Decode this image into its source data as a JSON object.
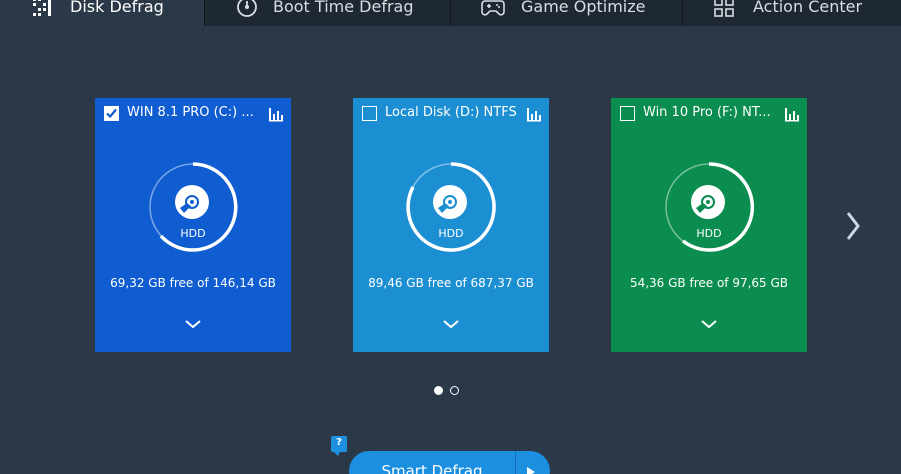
{
  "tabs": [
    {
      "label": "Disk Defrag",
      "icon": "disk-defrag-icon",
      "active": true
    },
    {
      "label": "Boot Time Defrag",
      "icon": "boot-time-icon",
      "active": false
    },
    {
      "label": "Game Optimize",
      "icon": "gamepad-icon",
      "active": false
    },
    {
      "label": "Action Center",
      "icon": "grid-icon",
      "active": false
    }
  ],
  "disks": [
    {
      "title": "WIN 8.1 PRO (C:) ...",
      "checked": true,
      "type": "HDD",
      "free_text": "69,32 GB free of 146,14 GB",
      "color": "#0f5dd1"
    },
    {
      "title": "Local Disk (D:) NTFS",
      "checked": false,
      "type": "HDD",
      "free_text": "89,46 GB free of 687,37 GB",
      "color": "#1c8fd3"
    },
    {
      "title": "Win 10 Pro (F:) NT...",
      "checked": false,
      "type": "HDD",
      "free_text": "54,36 GB free of 97,65 GB",
      "color": "#0a8d4e"
    }
  ],
  "pager": {
    "pages": 2,
    "current": 1
  },
  "help_label": "?",
  "action": {
    "label": "Smart Defrag"
  },
  "colors": {
    "background": "#2b3847",
    "tabbar": "#1e2832",
    "accent": "#1c8fe0"
  }
}
